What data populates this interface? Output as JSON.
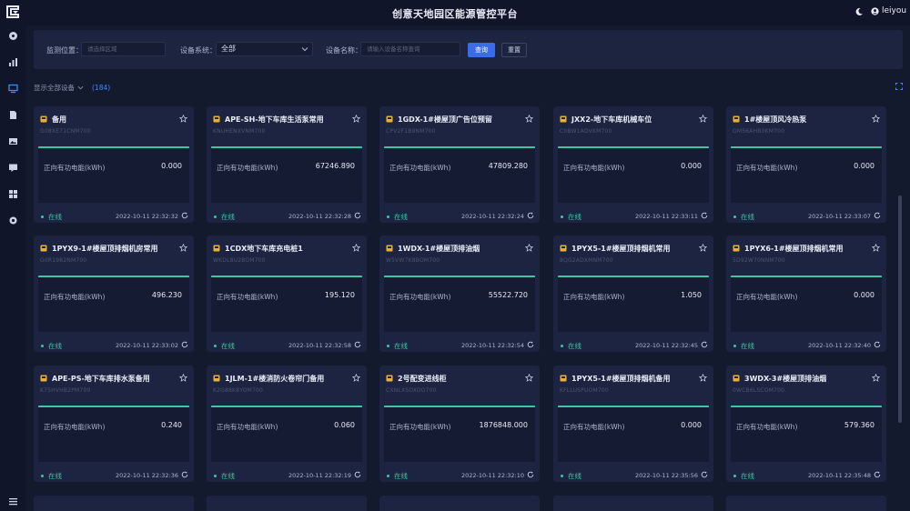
{
  "header": {
    "title": "创意天地园区能源管控平台",
    "username": "leiyou"
  },
  "filters": {
    "location_label": "监测位置：",
    "location_placeholder": "请选择区域",
    "system_label": "设备系统：",
    "system_value": "全部",
    "name_label": "设备名称：",
    "name_placeholder": "请输入设备名称查询",
    "query_button": "查询",
    "reset_button": "重置"
  },
  "list": {
    "show_all_label": "显示全部设备",
    "count": "(184)"
  },
  "metric_label": "正向有功电能(kWh)",
  "status_label": "在线",
  "colors": {
    "accent": "#3a6be8",
    "online": "#3fc6a2",
    "card_bg": "#1d2441",
    "page_bg": "#141a2e"
  },
  "devices": [
    {
      "name": "备用",
      "code": "G08XE71CNM700",
      "value": "0.000",
      "time": "2022-10-11 22:32:32"
    },
    {
      "name": "APE-SH-地下车库生活泵常用",
      "code": "KNUHENXVNM700",
      "value": "67246.890",
      "time": "2022-10-11 22:32:28"
    },
    {
      "name": "1GDX-1#楼屋顶广告位预留",
      "code": "CPV2F1B9NM700",
      "value": "47809.280",
      "time": "2022-10-11 22:32:24"
    },
    {
      "name": "JXX2-地下车库机械车位",
      "code": "C0BW1ADVKM700",
      "value": "0.000",
      "time": "2022-10-11 22:33:11"
    },
    {
      "name": "1#楼屋顶风冷热泵",
      "code": "GM56AHB0KM700",
      "value": "0.000",
      "time": "2022-10-11 22:33:07"
    },
    {
      "name": "1PYX9-1#楼屋顶排烟机房常用",
      "code": "G0R1982NM700",
      "value": "496.230",
      "time": "2022-10-11 22:33:02"
    },
    {
      "name": "1CDX地下车库充电桩1",
      "code": "WKDL8U2BOM700",
      "value": "195.120",
      "time": "2022-10-11 22:32:58"
    },
    {
      "name": "1WDX-1#楼屋顶排油烟",
      "code": "W5VW7K8BOM700",
      "value": "55522.720",
      "time": "2022-10-11 22:32:54"
    },
    {
      "name": "1PYX5-1#楼屋顶排烟机常用",
      "code": "8QG2ADXMNM700",
      "value": "1.050",
      "time": "2022-10-11 22:32:45"
    },
    {
      "name": "1PYX6-1#楼屋顶排烟机常用",
      "code": "5D92W70NNM700",
      "value": "0.000",
      "time": "2022-10-11 22:32:40"
    },
    {
      "name": "APE-PS-地下车库排水泵备用",
      "code": "K75HVHB2PM700",
      "value": "0.240",
      "time": "2022-10-11 22:32:36"
    },
    {
      "name": "1JLM-1#楼消防火卷帘门备用",
      "code": "K2G88K8YOM700",
      "value": "0.060",
      "time": "2022-10-11 22:32:19"
    },
    {
      "name": "2号配变进线柜",
      "code": "CXNLXSOXOO700",
      "value": "1876848.000",
      "time": "2022-10-11 22:32:10"
    },
    {
      "name": "1PYX5-1#楼屋顶排烟机备用",
      "code": "KFLLUSPUOM700",
      "value": "0.000",
      "time": "2022-10-11 22:35:56"
    },
    {
      "name": "3WDX-3#楼屋顶排油烟",
      "code": "0WCB6LSCOM700",
      "value": "579.360",
      "time": "2022-10-11 22:35:48"
    }
  ]
}
